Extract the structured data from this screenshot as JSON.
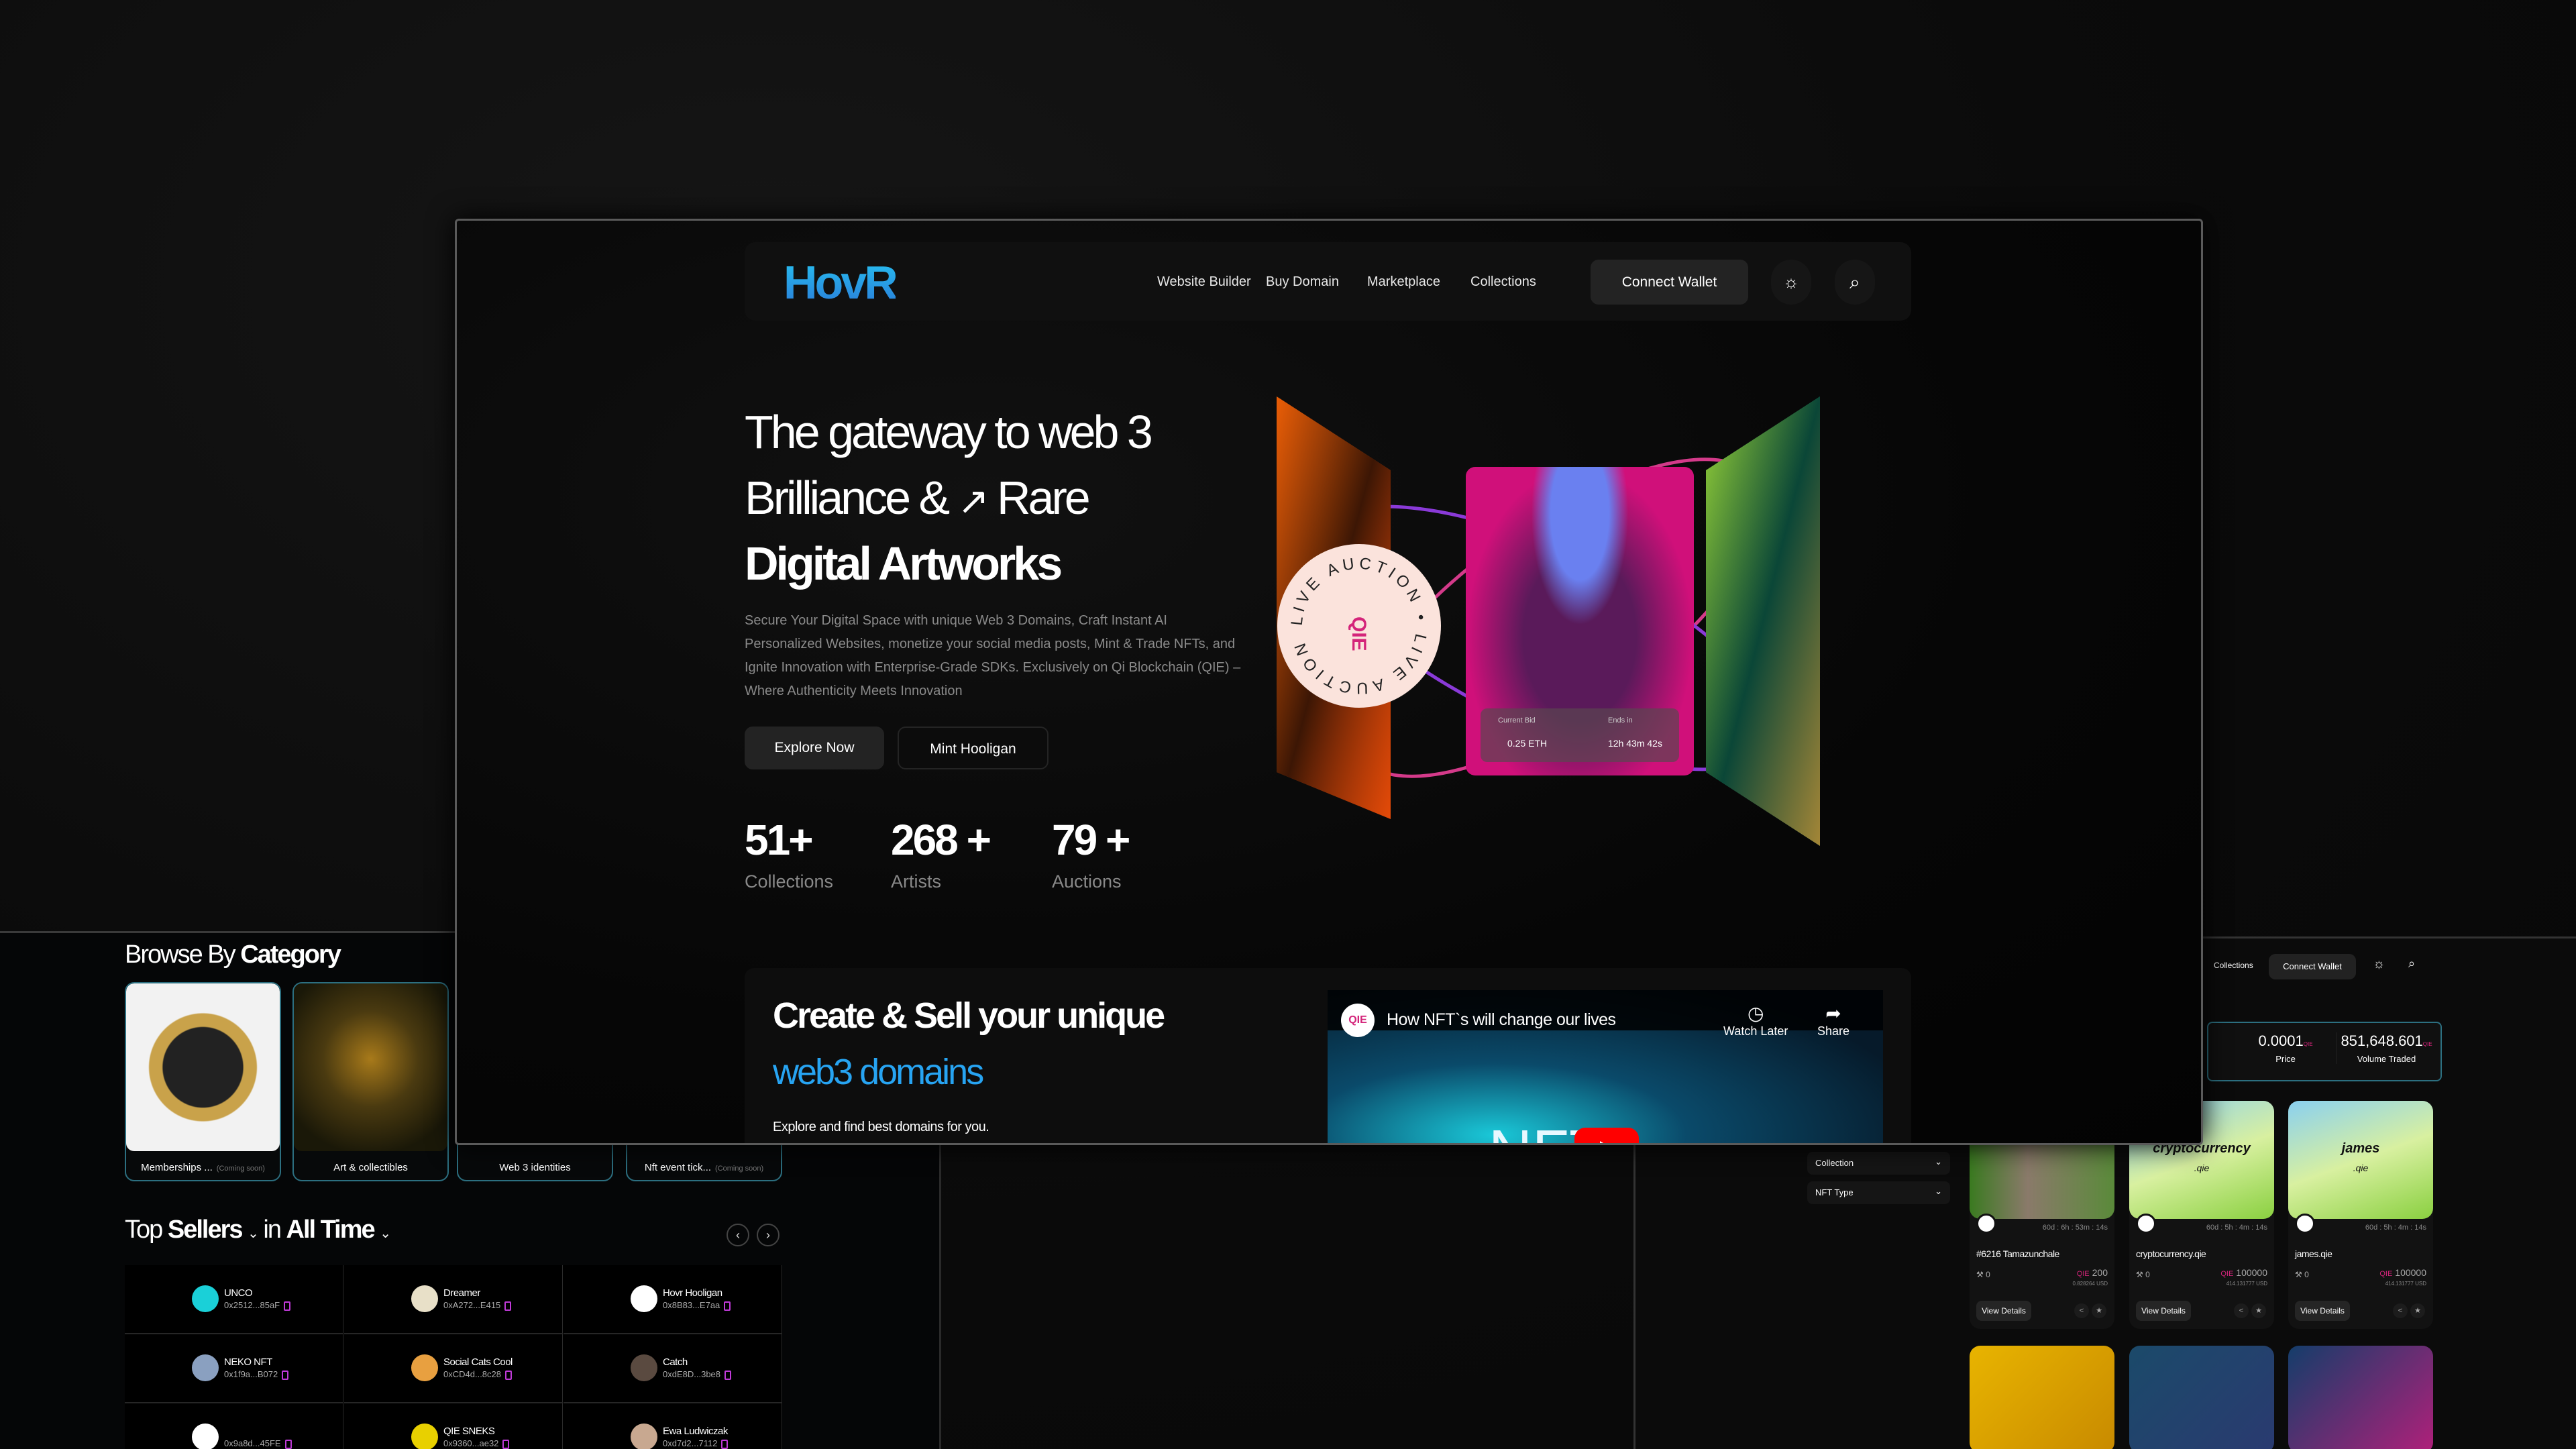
{
  "main": {
    "nav": {
      "logo": "HovR",
      "links": [
        "Website Builder",
        "Buy Domain",
        "Marketplace",
        "Collections"
      ],
      "connect_wallet": "Connect Wallet",
      "theme_icon": "sun-icon",
      "search_icon": "search-icon"
    },
    "hero": {
      "line1": "The gateway to web 3",
      "line2_a": "Brilliance &",
      "line2_b": "Rare",
      "line3": "Digital Artworks",
      "description": "Secure Your Digital Space with unique Web 3 Domains, Craft Instant AI Personalized Websites, monetize your social media posts, Mint & Trade NFTs, and Ignite Innovation with Enterprise-Grade SDKs. Exclusively on Qi Blockchain (QIE) – Where Authenticity Meets Innovation",
      "explore_button": "Explore Now",
      "mint_button": "Mint Hooligan",
      "stats": [
        {
          "value": "51+",
          "label": "Collections"
        },
        {
          "value": "268 +",
          "label": "Artists"
        },
        {
          "value": "79 +",
          "label": "Auctions"
        }
      ]
    },
    "auction": {
      "badge_text": "LIVE AUCTION • LIVE AUCTION •",
      "badge_logo": "QIE",
      "current_bid_label": "Current Bid",
      "current_bid": "0.25 ETH",
      "ends_label": "Ends in",
      "ends_in": "12h 43m 42s"
    },
    "domains": {
      "title": "Create & Sell your unique",
      "highlight": "web3 domains",
      "subtitle": "Explore and find best domains for you.",
      "video": {
        "channel": "QIE",
        "title": "How NFT`s will change our lives",
        "watch_later": "Watch Later",
        "share": "Share",
        "overlay_text": "NFT"
      }
    }
  },
  "left": {
    "browse": {
      "title_light": "Browse By",
      "title_bold": "Category",
      "categories": [
        {
          "label": "Memberships ...",
          "badge": "(Coming soon)"
        },
        {
          "label": "Art & collectibles",
          "badge": ""
        },
        {
          "label": "Web 3 identities",
          "badge": ""
        },
        {
          "label": "Nft event tick...",
          "badge": "(Coming soon)"
        }
      ]
    },
    "sellers": {
      "top": "Top",
      "sellers": "Sellers",
      "in": "in",
      "period": "All Time",
      "items": [
        {
          "name": "UNCO",
          "address": "0x2512...85aF"
        },
        {
          "name": "Dreamer",
          "address": "0xA272...E415"
        },
        {
          "name": "Hovr Hooligan",
          "address": "0x8B83...E7aa"
        },
        {
          "name": "NEKO NFT",
          "address": "0x1f9a...B072"
        },
        {
          "name": "Social Cats Cool",
          "address": "0xCD4d...8c28"
        },
        {
          "name": "Catch",
          "address": "0xdE8D...3be8"
        },
        {
          "name": "",
          "address": "0x9a8d...45FE"
        },
        {
          "name": "QIE SNEKS",
          "address": "0x9360...ae32"
        },
        {
          "name": "Ewa Ludwiczak",
          "address": "0xd7d2...7112"
        }
      ]
    }
  },
  "right": {
    "nav": {
      "collections": "Collections",
      "connect_wallet": "Connect Wallet"
    },
    "stats": [
      {
        "value": "0.0001",
        "label": "Price",
        "currency": "QIE"
      },
      {
        "value": "851,648.601",
        "label": "Volume Traded",
        "currency": "QIE"
      }
    ],
    "filters": [
      "Collection",
      "NFT Type"
    ],
    "cards": [
      {
        "name": "#6216 Tamazunchale",
        "time": "60d : 6h : 53m : 14s",
        "bids": "0",
        "currency": "QIE",
        "price": "200",
        "usd": "0.828264 USD",
        "button": "View Details",
        "image_title": "",
        "image_sub": ""
      },
      {
        "name": "cryptocurrency.qie",
        "time": "60d : 5h : 4m : 14s",
        "bids": "0",
        "currency": "QIE",
        "price": "100000",
        "usd": "414.131777 USD",
        "button": "View Details",
        "image_title": "cryptocurrency",
        "image_sub": ".qie"
      },
      {
        "name": "james.qie",
        "time": "60d : 5h : 4m : 14s",
        "bids": "0",
        "currency": "QIE",
        "price": "100000",
        "usd": "414.131777 USD",
        "button": "View Details",
        "image_title": "james",
        "image_sub": ".qie"
      }
    ]
  },
  "colors": {
    "accent_blue": "#27a4f2",
    "logo_green": "#7ed321",
    "border_teal": "#2c6f80",
    "copy_icon": "#c03ad8"
  }
}
